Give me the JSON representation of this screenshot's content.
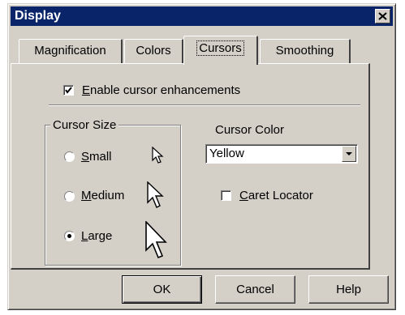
{
  "window": {
    "title": "Display"
  },
  "tabs": [
    {
      "label": "Magnification",
      "active": false
    },
    {
      "label": "Colors",
      "active": false
    },
    {
      "label": "Cursors",
      "active": true
    },
    {
      "label": "Smoothing",
      "active": false
    }
  ],
  "enable_cursor_enhancements": {
    "label_ul": "E",
    "label_rest": "nable cursor enhancements",
    "checked": true
  },
  "cursor_size": {
    "title": "Cursor Size",
    "options": [
      {
        "label_ul": "S",
        "label_rest": "mall",
        "selected": false,
        "icon": "small-arrow-cursor-icon"
      },
      {
        "label_ul": "M",
        "label_rest": "edium",
        "selected": false,
        "icon": "medium-arrow-cursor-icon"
      },
      {
        "label_ul": "L",
        "label_rest": "arge",
        "selected": true,
        "icon": "large-arrow-cursor-icon"
      }
    ]
  },
  "cursor_color": {
    "label": "Cursor Color",
    "value": "Yellow"
  },
  "caret_locator": {
    "label_ul": "C",
    "label_rest": "aret Locator",
    "checked": false
  },
  "buttons": {
    "ok": "OK",
    "cancel": "Cancel",
    "help": "Help"
  },
  "colors": {
    "titlebar": "#0a246a",
    "face": "#d4d0c8"
  }
}
